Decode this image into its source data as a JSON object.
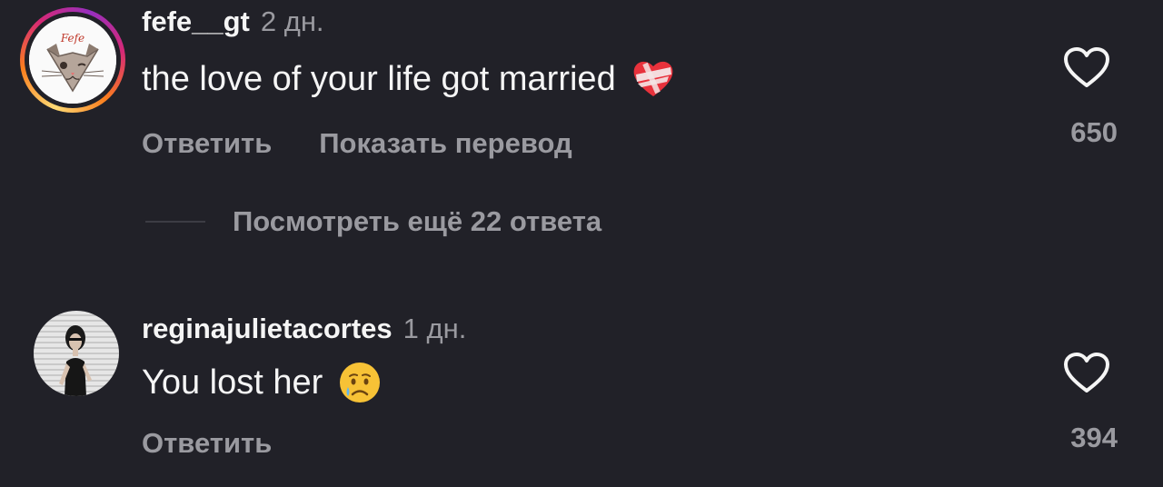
{
  "comments": [
    {
      "username": "fefe__gt",
      "time": "2 дн.",
      "text": "the love of your life got married",
      "emoji_icon": "mending-heart-emoji",
      "actions": {
        "reply": "Ответить",
        "translate": "Показать перевод"
      },
      "likes": "650",
      "avatar_label": "Fefe",
      "view_replies": "Посмотреть ещё 22 ответа"
    },
    {
      "username": "reginajulietacortes",
      "time": "1 дн.",
      "text": "You lost her",
      "emoji_icon": "crying-face-emoji",
      "actions": {
        "reply": "Ответить"
      },
      "likes": "394"
    }
  ],
  "colors": {
    "background": "#212128",
    "primary_text": "#f5f5f5",
    "secondary_text": "#9a9aa0",
    "story_ring": [
      "#feda75",
      "#fa7e1e",
      "#d62976",
      "#962fbf"
    ]
  }
}
